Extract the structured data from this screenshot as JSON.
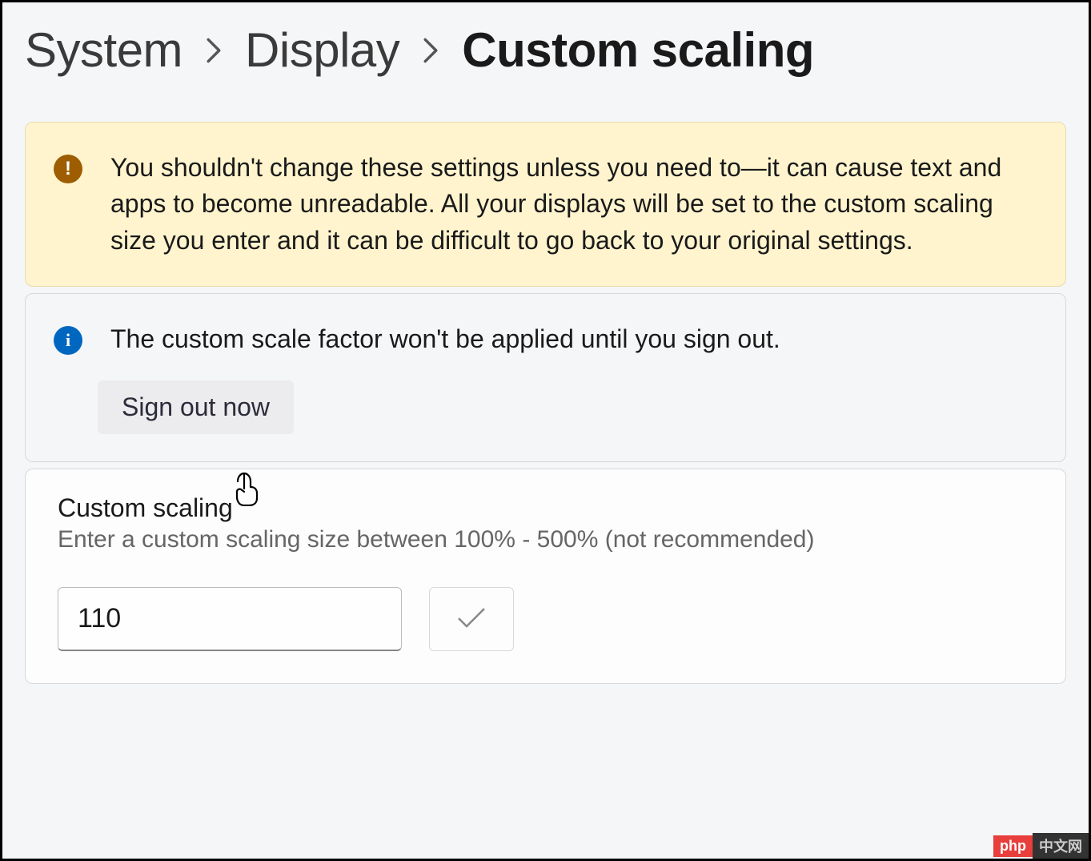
{
  "breadcrumb": {
    "items": [
      "System",
      "Display",
      "Custom scaling"
    ]
  },
  "warning": {
    "text": "You shouldn't change these settings unless you need to—it can cause text and apps to become unreadable. All your displays will be set to the custom scaling size you enter and it can be difficult to go back to your original settings."
  },
  "info": {
    "text": "The custom scale factor won't be applied until you sign out.",
    "sign_out_label": "Sign out now"
  },
  "setting": {
    "title": "Custom scaling",
    "description": "Enter a custom scaling size between 100% - 500% (not recommended)",
    "value": "110"
  },
  "watermark": {
    "left": "php",
    "right": "中文网"
  }
}
